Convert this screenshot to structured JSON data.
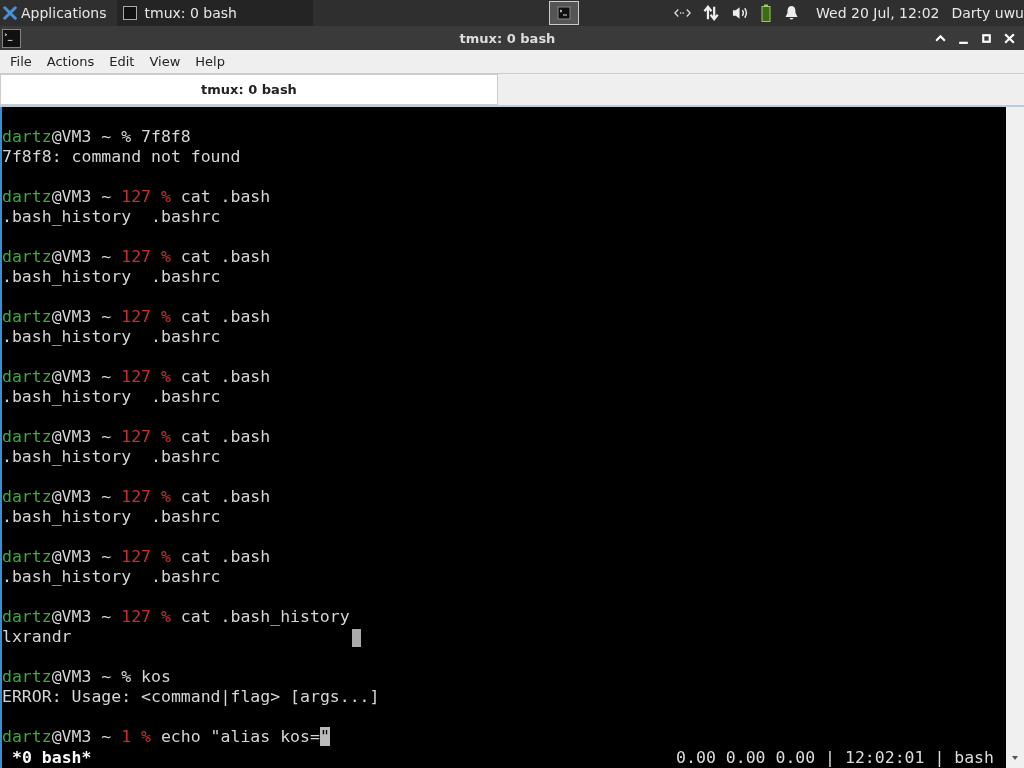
{
  "panel": {
    "apps_label": "Applications",
    "task": {
      "title": "tmux: 0 bash",
      "selected": false
    },
    "clock": "Wed 20 Jul, 12:02",
    "user": "Darty uwu"
  },
  "window": {
    "title": "tmux: 0 bash"
  },
  "menu": [
    "File",
    "Actions",
    "Edit",
    "View",
    "Help"
  ],
  "tabs": [
    {
      "label": "tmux: 0 bash",
      "selected": true
    }
  ],
  "terminal": {
    "lines": [
      {
        "kind": "blank"
      },
      {
        "kind": "prompt",
        "user": "dartz",
        "host": "@VM3 ~",
        "sign": "%",
        "command": "7f8f8"
      },
      {
        "kind": "output",
        "text": "7f8f8: command not found"
      },
      {
        "kind": "blank"
      },
      {
        "kind": "prompt",
        "user": "dartz",
        "host": "@VM3 ~",
        "status": "127",
        "sign": "%",
        "command": "cat .bash"
      },
      {
        "kind": "output",
        "text": ".bash_history  .bashrc"
      },
      {
        "kind": "blank"
      },
      {
        "kind": "prompt",
        "user": "dartz",
        "host": "@VM3 ~",
        "status": "127",
        "sign": "%",
        "command": "cat .bash"
      },
      {
        "kind": "output",
        "text": ".bash_history  .bashrc"
      },
      {
        "kind": "blank"
      },
      {
        "kind": "prompt",
        "user": "dartz",
        "host": "@VM3 ~",
        "status": "127",
        "sign": "%",
        "command": "cat .bash"
      },
      {
        "kind": "output",
        "text": ".bash_history  .bashrc"
      },
      {
        "kind": "blank"
      },
      {
        "kind": "prompt",
        "user": "dartz",
        "host": "@VM3 ~",
        "status": "127",
        "sign": "%",
        "command": "cat .bash"
      },
      {
        "kind": "output",
        "text": ".bash_history  .bashrc"
      },
      {
        "kind": "blank"
      },
      {
        "kind": "prompt",
        "user": "dartz",
        "host": "@VM3 ~",
        "status": "127",
        "sign": "%",
        "command": "cat .bash"
      },
      {
        "kind": "output",
        "text": ".bash_history  .bashrc"
      },
      {
        "kind": "blank"
      },
      {
        "kind": "prompt",
        "user": "dartz",
        "host": "@VM3 ~",
        "status": "127",
        "sign": "%",
        "command": "cat .bash"
      },
      {
        "kind": "output",
        "text": ".bash_history  .bashrc"
      },
      {
        "kind": "blank"
      },
      {
        "kind": "prompt",
        "user": "dartz",
        "host": "@VM3 ~",
        "status": "127",
        "sign": "%",
        "command": "cat .bash"
      },
      {
        "kind": "output",
        "text": ".bash_history  .bashrc"
      },
      {
        "kind": "blank"
      },
      {
        "kind": "prompt",
        "user": "dartz",
        "host": "@VM3 ~",
        "status": "127",
        "sign": "%",
        "command": "cat .bash_history"
      },
      {
        "kind": "output",
        "text": "lxrandr",
        "ghost_cursor": true
      },
      {
        "kind": "blank"
      },
      {
        "kind": "prompt",
        "user": "dartz",
        "host": "@VM3 ~",
        "sign": "%",
        "command": "kos"
      },
      {
        "kind": "output",
        "text": "ERROR: Usage: <command|flag> [args...]"
      },
      {
        "kind": "blank"
      },
      {
        "kind": "prompt",
        "user": "dartz",
        "host": "@VM3 ~",
        "status": "1",
        "sign": "%",
        "command": "echo \"alias kos=\"",
        "cursor": true
      }
    ],
    "status_bar": {
      "window": "*0 bash*",
      "right": "0.00 0.00 0.00 | 12:02:01 | bash"
    }
  }
}
